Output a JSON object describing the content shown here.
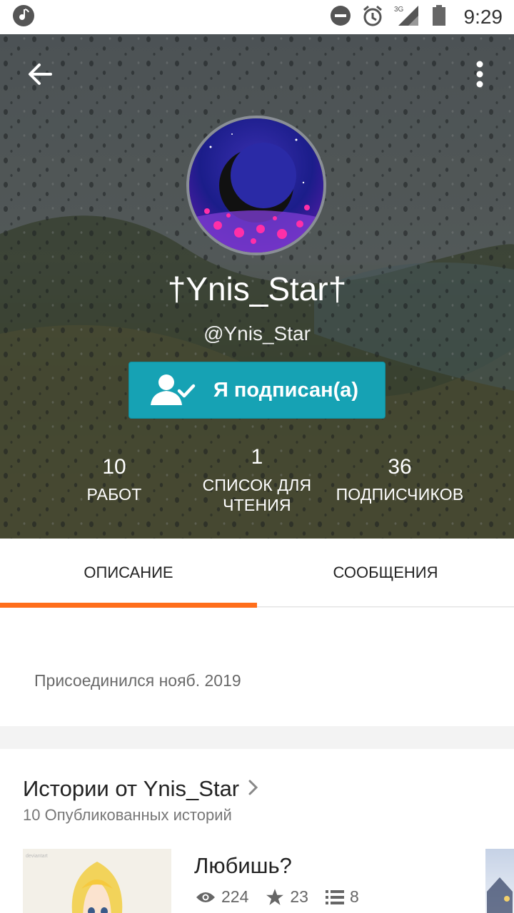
{
  "status_bar": {
    "time": "9:29",
    "network": "3G"
  },
  "profile": {
    "display_name": "†Ynis_Star†",
    "username": "@Ynis_Star",
    "follow_label": "Я подписан(а)",
    "stats": {
      "works_value": "10",
      "works_label": "РАБОТ",
      "reading_value": "1",
      "reading_label_line1": "СПИСОК ДЛЯ",
      "reading_label_line2": "ЧТЕНИЯ",
      "followers_value": "36",
      "followers_label": "ПОДПИСЧИКОВ"
    }
  },
  "tabs": [
    {
      "label": "ОПИСАНИЕ",
      "active": true
    },
    {
      "label": "СООБЩЕНИЯ",
      "active": false
    }
  ],
  "description": {
    "joined": "Присоединился нояб. 2019"
  },
  "stories": {
    "title": "Истории от Ynis_Star",
    "subtitle": "10 Опубликованных историй",
    "items": [
      {
        "title": "Любишь?",
        "reads": "224",
        "votes": "23",
        "parts": "8"
      }
    ]
  },
  "colors": {
    "accent": "#ff6e1b",
    "follow_button": "#16a2b4"
  }
}
